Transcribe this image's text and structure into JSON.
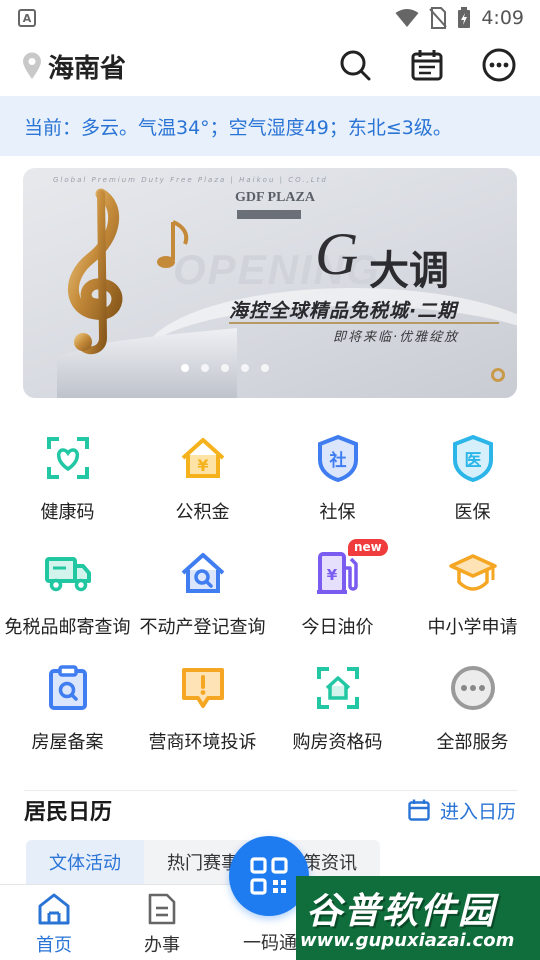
{
  "status_bar": {
    "time": "4:09",
    "notification_letter": "A"
  },
  "header": {
    "location": "海南省"
  },
  "weather": {
    "text": "当前：多云。气温34°；空气湿度49；东北≤3级。"
  },
  "banner": {
    "top_line": "Global Premium Duty Free Plaza | Haikou | CO.,Ltd",
    "logo": "GDF PLAZA",
    "opening": "OPENING",
    "g": "G",
    "title": "大调",
    "line1": "海控全球精品免税城·二期",
    "line2": "即将来临·优雅绽放",
    "slide_count": 5,
    "active_slide": 0
  },
  "services": [
    {
      "label": "健康码",
      "icon": "health-code-icon",
      "color": "#22c7a4"
    },
    {
      "label": "公积金",
      "icon": "housing-fund-icon",
      "color": "#f5b21c"
    },
    {
      "label": "社保",
      "icon": "social-security-icon",
      "color": "#3f7df0"
    },
    {
      "label": "医保",
      "icon": "medical-insurance-icon",
      "color": "#2bb5e8"
    },
    {
      "label": "免税品邮寄查询",
      "icon": "delivery-truck-icon",
      "color": "#20c7a0"
    },
    {
      "label": "不动产登记查询",
      "icon": "house-search-icon",
      "color": "#3f7df0"
    },
    {
      "label": "今日油价",
      "icon": "fuel-pump-icon",
      "color": "#7b5cf0",
      "badge": "new"
    },
    {
      "label": "中小学申请",
      "icon": "graduation-cap-icon",
      "color": "#f5a623"
    },
    {
      "label": "房屋备案",
      "icon": "clipboard-search-icon",
      "color": "#3f7df0"
    },
    {
      "label": "营商环境投诉",
      "icon": "complaint-icon",
      "color": "#f5a623"
    },
    {
      "label": "购房资格码",
      "icon": "house-scan-icon",
      "color": "#22c7a4"
    },
    {
      "label": "全部服务",
      "icon": "more-services-icon",
      "color": "#9a9a9a"
    }
  ],
  "calendar": {
    "title": "居民日历",
    "link": "进入日历",
    "tabs": [
      "文体活动",
      "热门赛事",
      "政策资讯"
    ]
  },
  "bottom_nav": [
    {
      "label": "首页",
      "icon": "home-icon"
    },
    {
      "label": "办事",
      "icon": "document-icon"
    },
    {
      "label": "一码通",
      "icon": "qr-code-icon"
    }
  ],
  "watermark": {
    "title": "谷普软件园",
    "url": "www.gupuxiazai.com"
  },
  "colors": {
    "accent": "#2a74d6",
    "weather_bg": "#e8f1fb",
    "fab": "#1f7cf0"
  }
}
